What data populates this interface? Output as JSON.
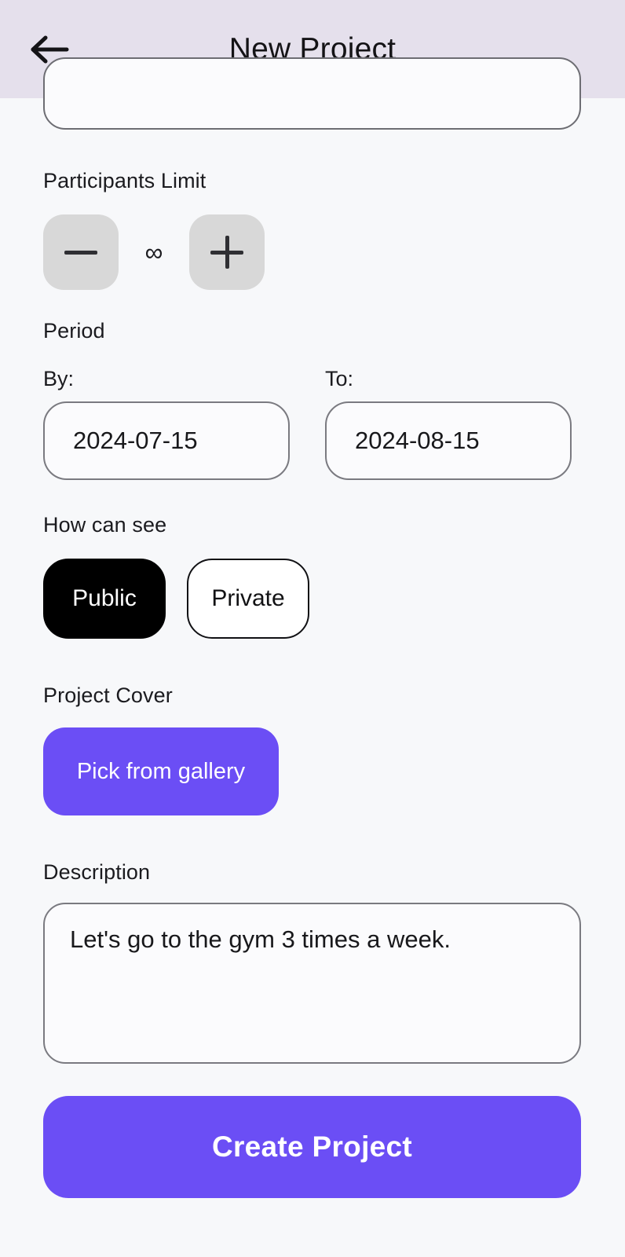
{
  "header": {
    "title": "New Project",
    "back_icon": "arrow-left-icon"
  },
  "form": {
    "participants": {
      "label": "Participants Limit",
      "decrement_label": "−",
      "increment_label": "+",
      "value": "∞"
    },
    "period": {
      "label": "Period",
      "from_label": "By:",
      "from_value": "2024-07-15",
      "to_label": "To:",
      "to_value": "2024-08-15"
    },
    "visibility": {
      "label": "How can see",
      "options": [
        {
          "label": "Public",
          "selected": true
        },
        {
          "label": "Private",
          "selected": false
        }
      ]
    },
    "cover": {
      "label": "Project Cover",
      "button_label": "Pick from gallery"
    },
    "description": {
      "label": "Description",
      "value": "Let's go to the gym 3 times a week.",
      "placeholder": "Description"
    },
    "submit_label": "Create Project"
  },
  "colors": {
    "header_bg": "#e5e0ec",
    "page_bg": "#f7f8fa",
    "accent_purple": "#6b4ef5",
    "selected_black": "#000000",
    "stepper_gray": "#d8d8d8",
    "border_gray": "#7a7a80"
  }
}
